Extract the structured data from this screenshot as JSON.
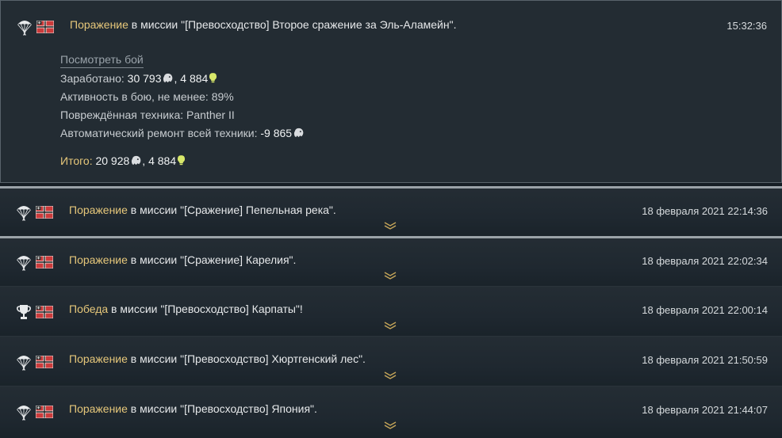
{
  "entries": [
    {
      "result": "Поражение",
      "message": " в миссии \"[Превосходство] Второе сражение за Эль-Аламейн\".",
      "time": "15:32:36",
      "icon": "parachute-icon",
      "nation": "germany-flag-icon",
      "expanded": true,
      "details": {
        "view_battle": "Посмотреть бой",
        "earned_label": "Заработано: ",
        "earned_lions": "30 793",
        "earned_rp": "4 884",
        "activity": "Активность в бою, не менее: 89%",
        "damaged": "Повреждённая техника: Panther II",
        "repair_label": "Автоматический ремонт всей техники: ",
        "repair_value": "-9 865",
        "total_label": "Итого: ",
        "total_lions": "20 928",
        "total_rp": "4 884"
      }
    },
    {
      "result": "Поражение",
      "message": " в миссии \"[Сражение] Пепельная река\".",
      "time": "18 февраля 2021 22:14:36",
      "icon": "parachute-icon",
      "nation": "germany-flag-icon"
    },
    {
      "result": "Поражение",
      "message": " в миссии \"[Сражение] Карелия\".",
      "time": "18 февраля 2021 22:02:34",
      "icon": "parachute-icon",
      "nation": "germany-flag-icon"
    },
    {
      "result": "Победа",
      "message": " в миссии \"[Превосходство] Карпаты\"!",
      "time": "18 февраля 2021 22:00:14",
      "icon": "trophy-icon",
      "nation": "germany-flag-icon"
    },
    {
      "result": "Поражение",
      "message": " в миссии \"[Превосходство] Хюртгенский лес\".",
      "time": "18 февраля 2021 21:50:59",
      "icon": "parachute-icon",
      "nation": "germany-flag-icon"
    },
    {
      "result": "Поражение",
      "message": " в миссии \"[Превосходство] Япония\".",
      "time": "18 февраля 2021 21:44:07",
      "icon": "parachute-icon",
      "nation": "germany-flag-icon"
    }
  ]
}
